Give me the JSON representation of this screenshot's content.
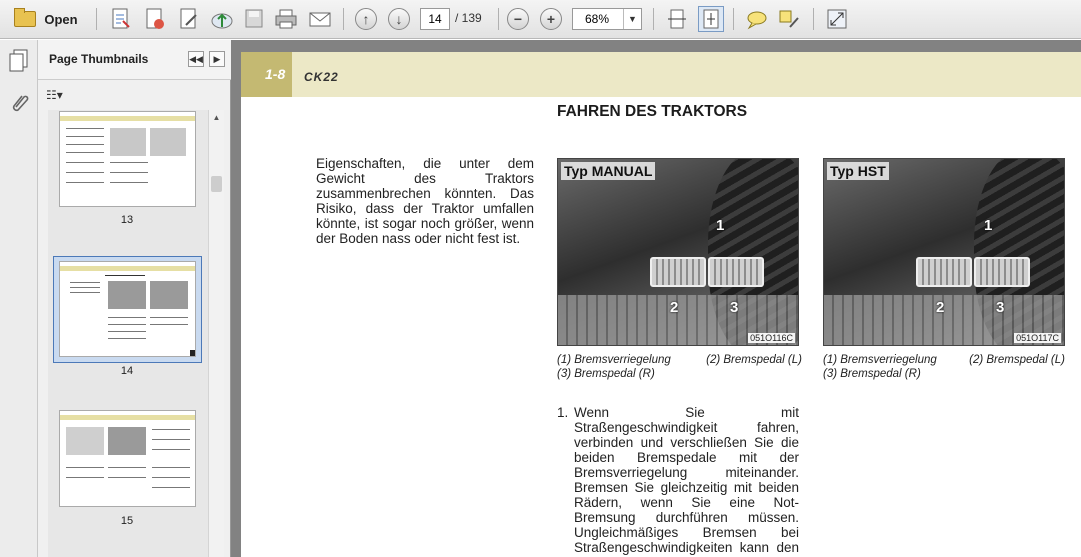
{
  "toolbar": {
    "open_label": "Open",
    "page_current": "14",
    "page_total": "/ 139",
    "zoom_value": "68%",
    "icons": [
      "folder-icon",
      "create-pdf-icon",
      "save-as-icon",
      "edit-icon",
      "upload-icon",
      "save-icon",
      "print-icon",
      "email-icon",
      "previous-page-icon",
      "next-page-icon",
      "zoom-out-icon",
      "zoom-in-icon",
      "fit-width-icon",
      "fit-page-icon",
      "comment-icon",
      "highlight-icon",
      "full-screen-icon"
    ]
  },
  "sidebar": {
    "panel_title": "Page Thumbnails",
    "thumbnails": [
      {
        "label": "13"
      },
      {
        "label": "14",
        "selected": true
      },
      {
        "label": "15"
      }
    ]
  },
  "document": {
    "page_number": "1-8",
    "model": "CK22",
    "section_title": "FAHREN DES TRAKTORS",
    "intro_text": "Eigenschaften, die unter dem Gewicht des Traktors zusammenbrechen könnten. Das Risiko, dass der Traktor umfallen könnte, ist sogar noch größer, wenn der Boden nass oder nicht fest ist.",
    "figures": [
      {
        "label": "Typ MANUAL",
        "ref": "051O116C",
        "num1": "1",
        "num2": "2",
        "num3": "3",
        "caption_1": "(1)  Bremsverriegelung",
        "caption_2": "(2)  Bremspedal (L)",
        "caption_3": "(3)  Bremspedal (R)"
      },
      {
        "label": "Typ HST",
        "ref": "051O117C",
        "num1": "1",
        "num2": "2",
        "num3": "3",
        "caption_1": "(1)  Bremsverriegelung",
        "caption_2": "(2)  Bremspedal (L)",
        "caption_3": "(3)  Bremspedal (R)"
      }
    ],
    "step": {
      "number": "1.",
      "text": "Wenn Sie mit Straßengeschwindigkeit fahren, verbinden und verschließen Sie die beiden Bremspedale mit der Bremsverriegelung miteinander. Bremsen Sie gleichzeitig mit beiden Rädern, wenn Sie eine Not-Bremsung durchführen müssen. Ungleichmäßiges Bremsen bei Straßengeschwindigkeiten kann den Traktor zum Umfallen bringen."
    }
  },
  "colors": {
    "header_band": "#ece8c6",
    "page_tab": "#c4b972",
    "viewer_bg": "#828282",
    "selection": "#4c79b8"
  }
}
